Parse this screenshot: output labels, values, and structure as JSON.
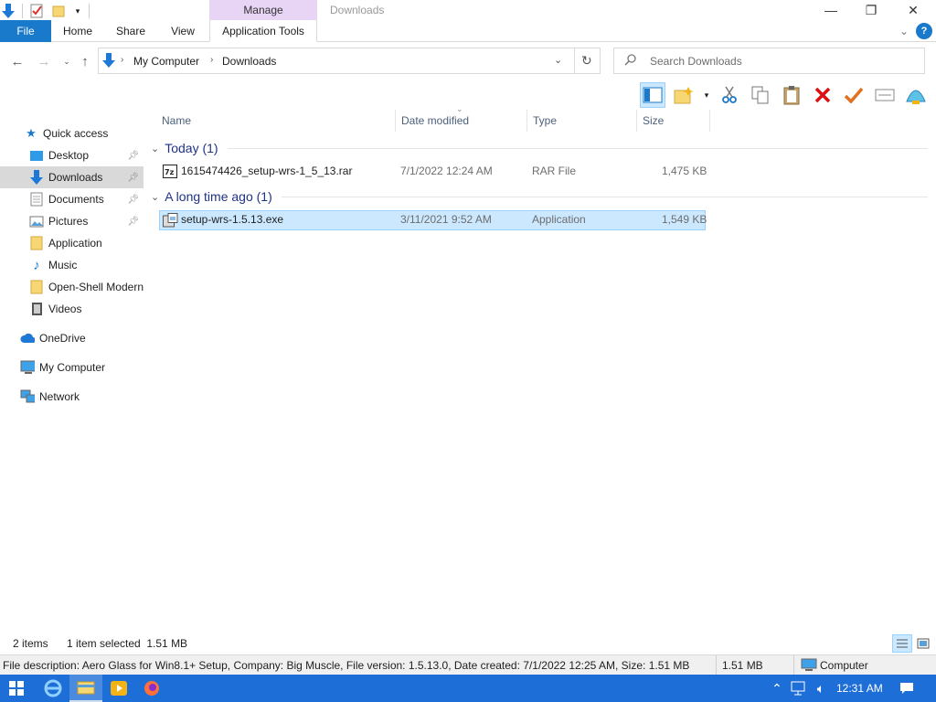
{
  "window": {
    "title": "Downloads",
    "contextual_group": "Manage"
  },
  "ribbon": {
    "tabs": [
      "File",
      "Home",
      "Share",
      "View",
      "Application Tools"
    ]
  },
  "address": {
    "crumbs": [
      "My Computer",
      "Downloads"
    ]
  },
  "search": {
    "placeholder": "Search Downloads"
  },
  "nav": {
    "quick_access": "Quick access",
    "items": [
      "Desktop",
      "Downloads",
      "Documents",
      "Pictures",
      "Application",
      "Music",
      "Open-Shell Modern",
      "Videos"
    ],
    "onedrive": "OneDrive",
    "my_computer": "My Computer",
    "network": "Network"
  },
  "columns": {
    "name": "Name",
    "date": "Date modified",
    "type": "Type",
    "size": "Size"
  },
  "groups": [
    {
      "title": "Today (1)",
      "files": [
        {
          "name": "1615474426_setup-wrs-1_5_13.rar",
          "date": "7/1/2022 12:24 AM",
          "type": "RAR File",
          "size": "1,475 KB"
        }
      ]
    },
    {
      "title": "A long time ago (1)",
      "files": [
        {
          "name": "setup-wrs-1.5.13.exe",
          "date": "3/11/2021 9:52 AM",
          "type": "Application",
          "size": "1,549 KB"
        }
      ]
    }
  ],
  "status": {
    "items": "2 items",
    "selection": "1 item selected  1.51 MB"
  },
  "details": {
    "description": "File description: Aero Glass for Win8.1+ Setup, Company: Big Muscle, File version: 1.5.13.0, Date created: 7/1/2022 12:25 AM, Size: 1.51 MB",
    "size": "1.51 MB",
    "location": "Computer"
  },
  "taskbar": {
    "time": "12:31 AM"
  },
  "colors": {
    "accent": "#1979ca",
    "selection": "#cce8ff",
    "taskbar": "#1e6ed8",
    "manage": "#e8d5f6"
  }
}
